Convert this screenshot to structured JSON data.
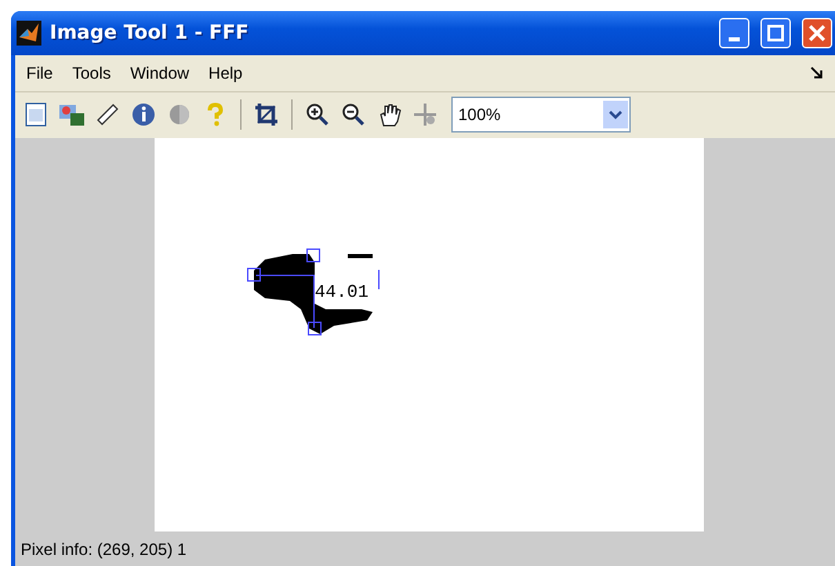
{
  "window": {
    "title": "Image Tool 1 - FFF"
  },
  "menu": [
    "File",
    "Tools",
    "Window",
    "Help"
  ],
  "zoom_field": {
    "value": "100%"
  },
  "measurement": {
    "label": "44.01"
  },
  "status_bar": "Pixel info: (269, 205)  1"
}
